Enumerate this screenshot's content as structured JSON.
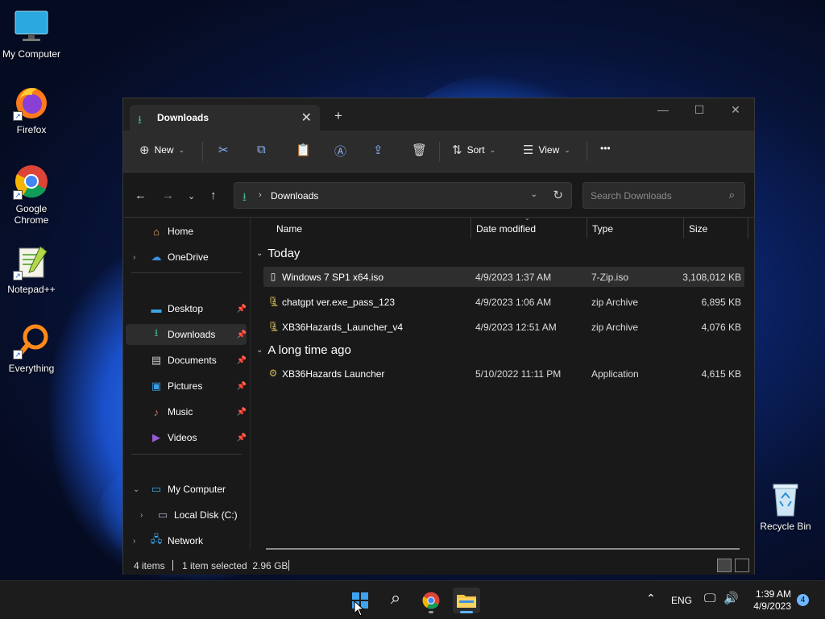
{
  "desktop": {
    "icons": [
      {
        "label": "My Computer"
      },
      {
        "label": "Firefox"
      },
      {
        "label": "Google Chrome"
      },
      {
        "label": "Notepad++"
      },
      {
        "label": "Everything"
      },
      {
        "label": "Recycle Bin"
      }
    ]
  },
  "window": {
    "tab_title": "Downloads",
    "toolbar": {
      "new_label": "New",
      "sort_label": "Sort",
      "view_label": "View",
      "more_label": "•••"
    },
    "address": {
      "path": "Downloads",
      "search_placeholder": "Search Downloads"
    },
    "nav_pane": {
      "home": "Home",
      "onedrive": "OneDrive",
      "quick_access": [
        "Desktop",
        "Downloads",
        "Documents",
        "Pictures",
        "Music",
        "Videos"
      ],
      "my_computer": "My Computer",
      "local_disk": "Local Disk (C:)",
      "network": "Network"
    },
    "columns": [
      "Name",
      "Date modified",
      "Type",
      "Size"
    ],
    "groups": [
      {
        "label": "Today",
        "files": [
          {
            "name": "Windows 7 SP1 x64.iso",
            "date": "4/9/2023 1:37 AM",
            "type": "7-Zip.iso",
            "size": "3,108,012 KB",
            "selected": true
          },
          {
            "name": "chatgpt ver.exe_pass_123",
            "date": "4/9/2023 1:06 AM",
            "type": "zip Archive",
            "size": "6,895 KB"
          },
          {
            "name": "XB36Hazards_Launcher_v4",
            "date": "4/9/2023 12:51 AM",
            "type": "zip Archive",
            "size": "4,076 KB"
          }
        ]
      },
      {
        "label": "A long time ago",
        "files": [
          {
            "name": "XB36Hazards Launcher",
            "date": "5/10/2022 11:11 PM",
            "type": "Application",
            "size": "4,615 KB"
          }
        ]
      }
    ],
    "status": {
      "items": "4 items",
      "selection": "1 item selected  2.96 GB"
    }
  },
  "taskbar": {
    "lang": "ENG",
    "time": "1:39 AM",
    "date": "4/9/2023",
    "notifications": "4"
  },
  "colors": {
    "accent": "#3fb27f",
    "window_bg": "#191919",
    "toolbar_bg": "#2c2c2c"
  }
}
